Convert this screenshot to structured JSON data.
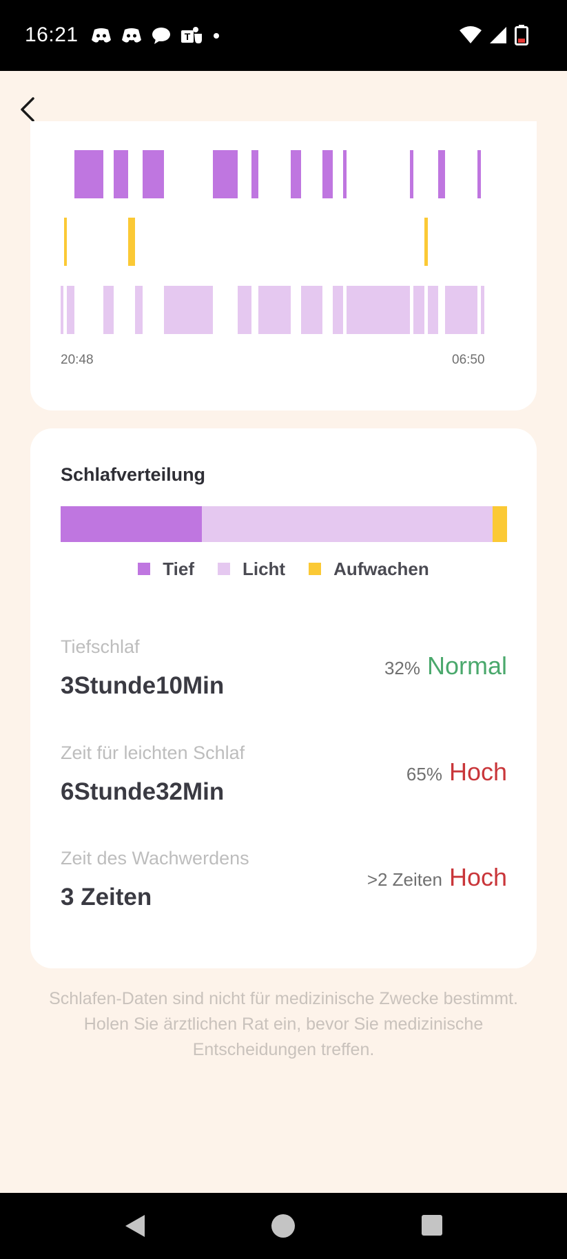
{
  "status_bar": {
    "time": "16:21",
    "notification_icons": [
      "discord-icon",
      "discord-icon",
      "chat-bubble-icon",
      "teams-icon",
      "dot-icon"
    ],
    "system_icons": [
      "wifi-icon",
      "signal-icon",
      "battery-low-icon"
    ]
  },
  "header": {
    "back_icon": "chevron-left-icon"
  },
  "timeline": {
    "start_time": "20:48",
    "end_time": "06:50",
    "colors": {
      "deep": "#bf76e0",
      "light": "#e5c8f0",
      "awake": "#fbc935"
    }
  },
  "distribution": {
    "title": "Schlafverteilung",
    "bar": [
      {
        "type": "deep",
        "fraction": 0.316,
        "color": "#bf76e0"
      },
      {
        "type": "light",
        "fraction": 0.652,
        "color": "#e5c8f0"
      },
      {
        "type": "awake",
        "fraction": 0.032,
        "color": "#fbc935"
      }
    ],
    "legend": [
      {
        "label": "Tief",
        "color": "#bf76e0"
      },
      {
        "label": "Licht",
        "color": "#e5c8f0"
      },
      {
        "label": "Aufwachen",
        "color": "#fbc935"
      }
    ],
    "stats": [
      {
        "label": "Tiefschlaf",
        "value": "3Stunde10Min",
        "percent": "32%",
        "status": "Normal",
        "status_color": "#4aa86c"
      },
      {
        "label": "Zeit für leichten Schlaf",
        "value": "6Stunde32Min",
        "percent": "65%",
        "status": "Hoch",
        "status_color": "#c9363a"
      },
      {
        "label": "Zeit des Wachwerdens",
        "value": "3 Zeiten",
        "percent": ">2 Zeiten",
        "status": "Hoch",
        "status_color": "#c9363a"
      }
    ]
  },
  "disclaimer": "Schlafen-Daten sind nicht für medizinische Zwecke bestimmt. Holen Sie ärztlichen Rat ein, bevor Sie medizinische Entscheidungen treffen.",
  "nav_bar": {
    "icons": [
      "nav-back-icon",
      "nav-home-icon",
      "nav-recents-icon"
    ]
  }
}
